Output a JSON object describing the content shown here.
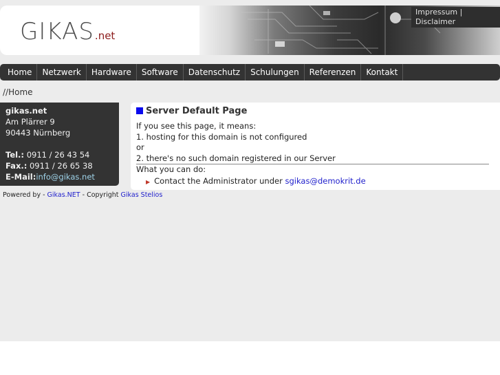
{
  "header": {
    "logo_main": "GIKAS",
    "logo_ext": ".net",
    "topnav": [
      "Impressum |",
      "Disclaimer"
    ]
  },
  "menu": [
    "Home",
    "Netzwerk",
    "Hardware",
    "Software",
    "Datenschutz",
    "Schulungen",
    "Referenzen",
    "Kontakt"
  ],
  "breadcrumb": "//Home",
  "sidebar": {
    "name": "gikas.net",
    "street": "Am Plärrer 9",
    "city": "90443 Nürnberg",
    "tel_label": "Tel.:",
    "tel": "0911 / 26 43 54",
    "fax_label": "Fax.:",
    "fax": "0911 / 26 65 38",
    "email_label": "E-Mail:",
    "email": "info@gikas.net"
  },
  "content": {
    "title": "Server Default Page",
    "line1": "If you see this page, it means:",
    "line2": "1. hosting for this domain is not configured",
    "line3": "or",
    "line4": "2. there's no such domain registered in our Server",
    "line5": "What you can do:",
    "action_text": "Contact the Administrator under",
    "action_link": "sgikas@demokrit.de"
  },
  "footer": {
    "prefix": "Powered by -",
    "link1": "Gikas.NET",
    "middle": "- Copyright",
    "link2": "Gikas Stelios"
  }
}
